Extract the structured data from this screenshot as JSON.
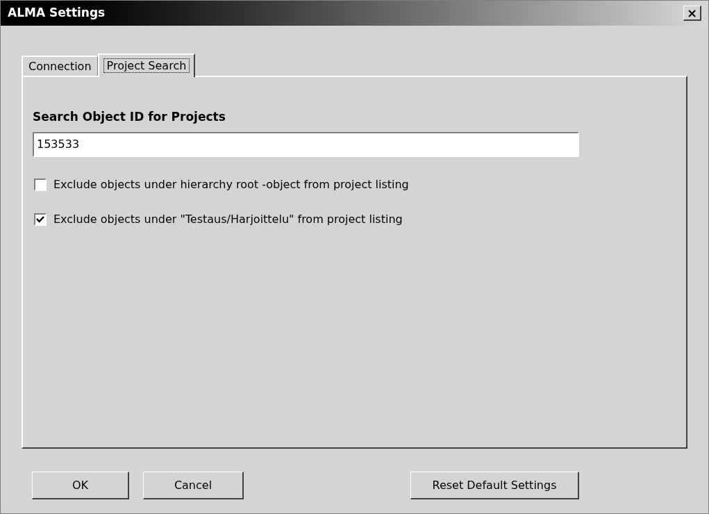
{
  "window": {
    "title": "ALMA Settings",
    "close": "×"
  },
  "tabs": [
    {
      "label": "Connection",
      "selected": false
    },
    {
      "label": "Project Search",
      "selected": true
    }
  ],
  "search_object": {
    "label": "Search Object ID for Projects",
    "value": "153533"
  },
  "options": [
    {
      "label": "Exclude objects under hierarchy root -object from project listing",
      "checked": false
    },
    {
      "label": "Exclude objects under \"Testaus/Harjoittelu\" from project listing",
      "checked": true
    }
  ],
  "buttons": [
    "OK",
    "Cancel",
    "Reset Default Settings"
  ]
}
